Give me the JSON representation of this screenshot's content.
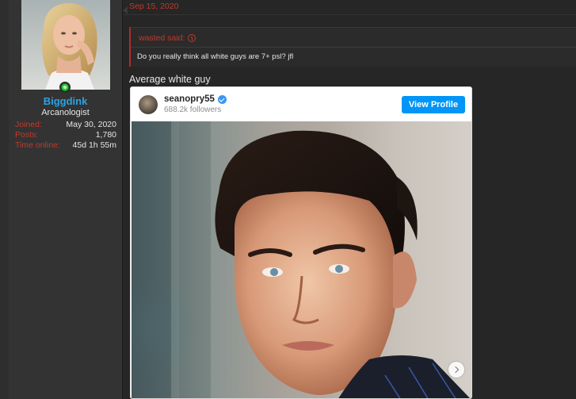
{
  "post": {
    "date": "Sep 15, 2020",
    "text": "Average white guy"
  },
  "user": {
    "username": "Biggdink",
    "title": "Arcanologist",
    "stats": [
      {
        "label": "Joined:",
        "value": "May 30, 2020"
      },
      {
        "label": "Posts:",
        "value": "1,780"
      },
      {
        "label": "Time online:",
        "value": "45d 1h 55m"
      }
    ]
  },
  "quote": {
    "author_said": "wasted said:",
    "body": "Do you really think all white guys are 7+ psl? jfl"
  },
  "embed": {
    "username": "seanopry55",
    "followers": "688.2k followers",
    "view_profile_label": "View Profile"
  },
  "icons": {
    "online": "online-status-icon",
    "quote_link": "arrow-up-circle-icon",
    "verified": "verified-badge-icon",
    "carousel_next": "chevron-right-icon"
  },
  "colors": {
    "username": "#29a3e6",
    "accent_red": "#c0392b",
    "view_profile_bg": "#0095f6"
  }
}
